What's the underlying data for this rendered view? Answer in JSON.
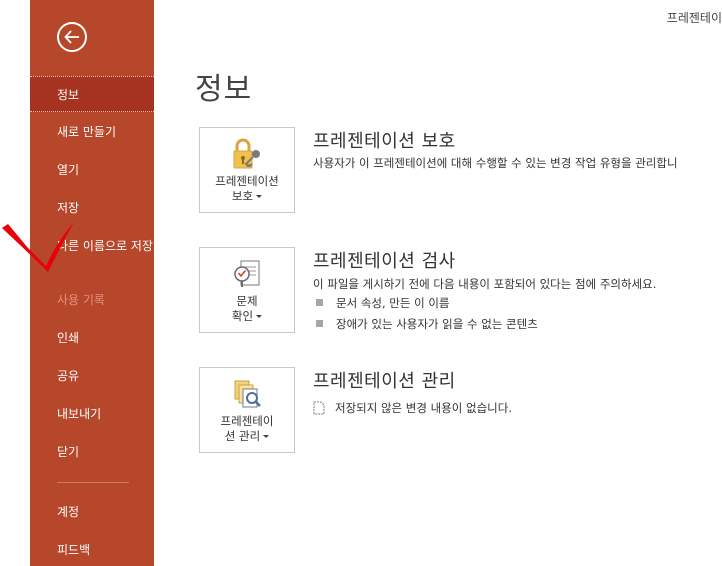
{
  "window": {
    "title": "프레젠테이"
  },
  "sidebar": {
    "items": [
      {
        "label": "정보"
      },
      {
        "label": "새로 만들기"
      },
      {
        "label": "열기"
      },
      {
        "label": "저장"
      },
      {
        "label": "다른 이름으로 저장"
      },
      {
        "label": "사용 기록"
      },
      {
        "label": "인쇄"
      },
      {
        "label": "공유"
      },
      {
        "label": "내보내기"
      },
      {
        "label": "닫기"
      },
      {
        "label": "계정"
      },
      {
        "label": "피드백"
      }
    ]
  },
  "page": {
    "title": "정보"
  },
  "sections": {
    "protect": {
      "button_line1": "프레젠테이션",
      "button_line2": "보호",
      "title": "프레젠테이션 보호",
      "description": "사용자가 이 프레젠테이션에 대해 수행할 수 있는 변경 작업 유형을 관리합니"
    },
    "inspect": {
      "button_line1": "문제",
      "button_line2": "확인",
      "title": "프레젠테이션 검사",
      "description": "이 파일을 게시하기 전에 다음 내용이 포함되어 있다는 점에 주의하세요.",
      "bullets": [
        "문서 속성, 만든 이 이름",
        "장애가 있는 사용자가 읽을 수 없는 콘텐츠"
      ]
    },
    "manage": {
      "button_line1": "프레젠테이",
      "button_line2": "션 관리",
      "title": "프레젠테이션 관리",
      "status": "저장되지 않은 변경 내용이 없습니다."
    }
  },
  "colors": {
    "sidebar": "#b7472a",
    "sidebar_selected": "#a6331f",
    "annotation": "#e8000b"
  }
}
